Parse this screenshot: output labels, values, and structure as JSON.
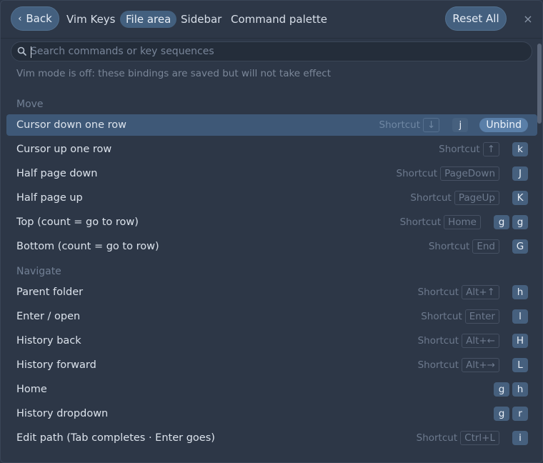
{
  "topbar": {
    "back_label": "Back",
    "title": "Vim Keys",
    "tabs": [
      "File area",
      "Sidebar",
      "Command palette"
    ],
    "reset_label": "Reset All",
    "close_glyph": "×"
  },
  "search": {
    "placeholder": "Search commands or key sequences",
    "value": ""
  },
  "notice": "Vim mode is off: these bindings are saved but will not take effect",
  "sections": [
    {
      "title": "Move",
      "rows": [
        {
          "label": "Cursor down one row",
          "shortcut": "↓",
          "keys": [
            "j"
          ],
          "selected": true,
          "action": "Unbind"
        },
        {
          "label": "Cursor up one row",
          "shortcut": "↑",
          "keys": [
            "k"
          ]
        },
        {
          "label": "Half page down",
          "shortcut": "PageDown",
          "keys": [
            "J"
          ]
        },
        {
          "label": "Half page up",
          "shortcut": "PageUp",
          "keys": [
            "K"
          ]
        },
        {
          "label": "Top (count = go to row)",
          "shortcut": "Home",
          "keys": [
            "g",
            "g"
          ]
        },
        {
          "label": "Bottom (count = go to row)",
          "shortcut": "End",
          "keys": [
            "G"
          ]
        }
      ]
    },
    {
      "title": "Navigate",
      "rows": [
        {
          "label": "Parent folder",
          "shortcut": "Alt+↑",
          "keys": [
            "h"
          ]
        },
        {
          "label": "Enter / open",
          "shortcut": "Enter",
          "keys": [
            "l"
          ]
        },
        {
          "label": "History back",
          "shortcut": "Alt+←",
          "keys": [
            "H"
          ]
        },
        {
          "label": "History forward",
          "shortcut": "Alt+→",
          "keys": [
            "L"
          ]
        },
        {
          "label": "Home",
          "shortcut": null,
          "keys": [
            "g",
            "h"
          ]
        },
        {
          "label": "History dropdown",
          "shortcut": null,
          "keys": [
            "g",
            "r"
          ]
        },
        {
          "label": "Edit path (Tab completes · Enter goes)",
          "shortcut": "Ctrl+L",
          "keys": [
            "i"
          ]
        }
      ]
    }
  ],
  "shortcut_word": "Shortcut",
  "colors": {
    "background": "#2d3747",
    "accent": "#44607f",
    "selected_row": "#3e5877",
    "key_chip": "#46607e"
  }
}
